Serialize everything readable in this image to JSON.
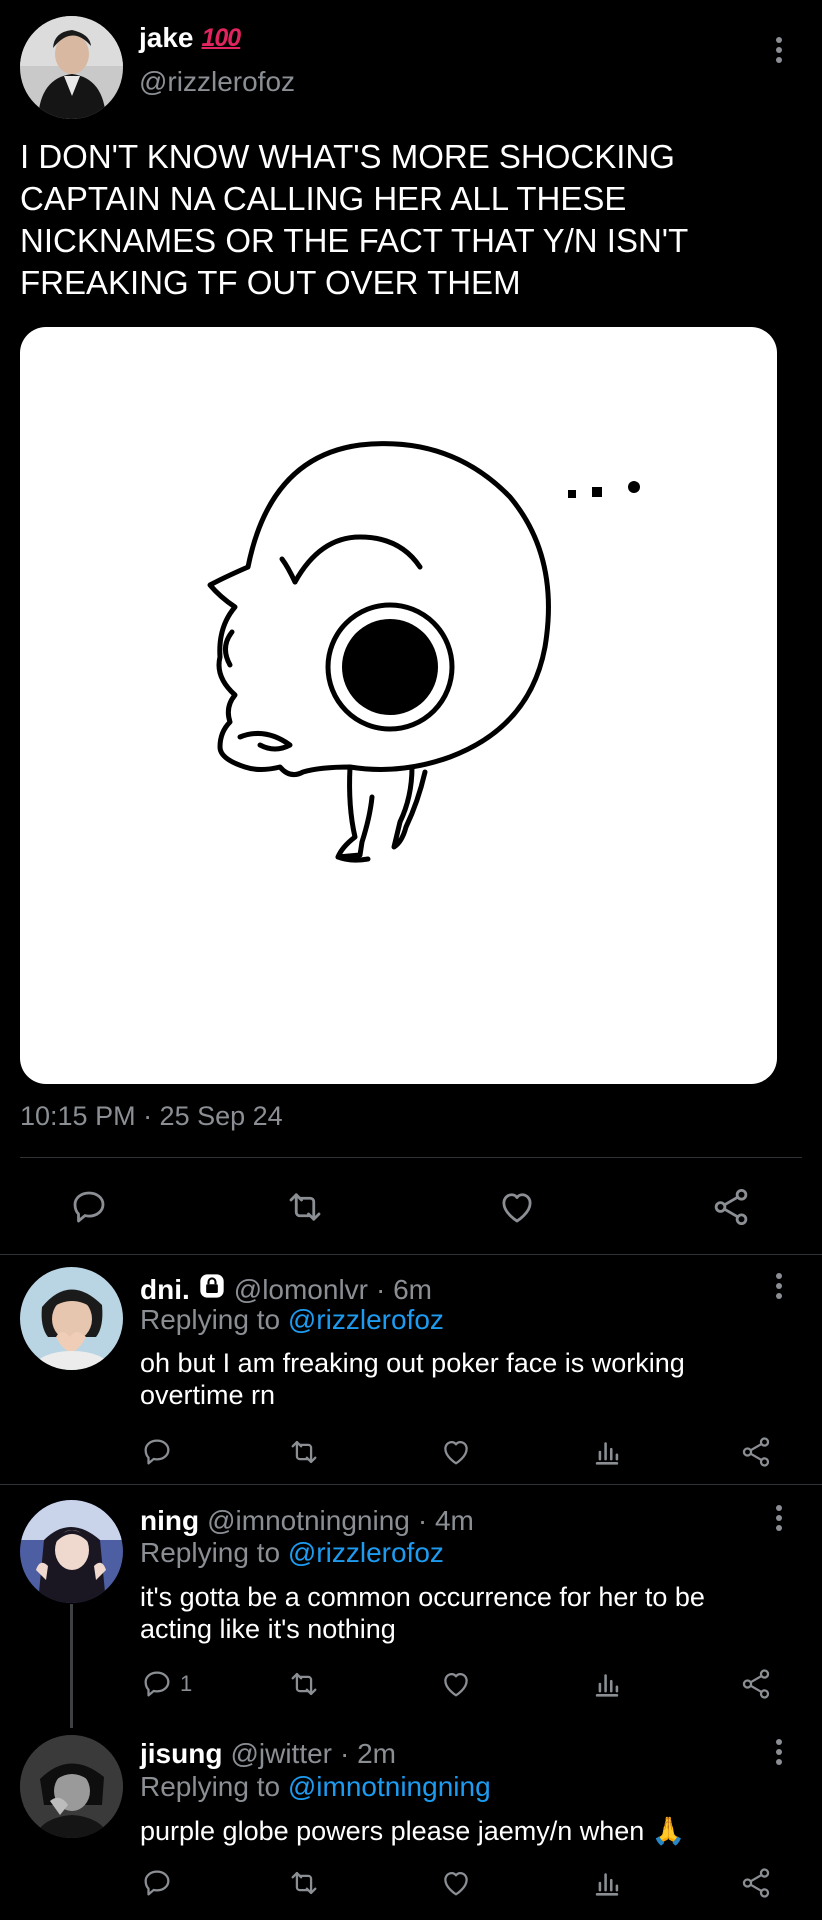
{
  "main_tweet": {
    "name": "jake",
    "emoji": "100",
    "handle": "@rizzlerofoz",
    "text": "I DON'T KNOW WHAT'S MORE SHOCKING CAPTAIN NA CALLING HER ALL THESE NICKNAMES OR THE FACT THAT Y/N ISN'T FREAKING TF OUT OVER THEM",
    "timestamp": "10:15 PM · 25 Sep 24",
    "media_icon": "doodle-face-image"
  },
  "replies": [
    {
      "name": "dni.",
      "badge_icon": "lock-icon",
      "handle": "@lomonlvr",
      "time": "· 6m",
      "replying_label": "Replying to",
      "replying_to": "@rizzlerofoz",
      "text": "oh but I am freaking out poker face is working overtime rn",
      "reply_count": ""
    },
    {
      "name": "ning",
      "handle": "@imnotningning",
      "time": "· 4m",
      "replying_label": "Replying to",
      "replying_to": "@rizzlerofoz",
      "text": "it's gotta be a common occurrence for her to be acting like it's nothing",
      "reply_count": "1"
    },
    {
      "name": "jisung",
      "handle": "@jwitter",
      "time": "· 2m",
      "replying_label": "Replying to",
      "replying_to": "@imnotningning",
      "text": "purple globe powers please jaemy/n when 🙏",
      "reply_count": ""
    }
  ],
  "colors": {
    "background": "#000000",
    "text": "#e7e9ea",
    "muted": "#8b8f94",
    "link": "#1d9bf0",
    "divider": "#2f3336"
  }
}
